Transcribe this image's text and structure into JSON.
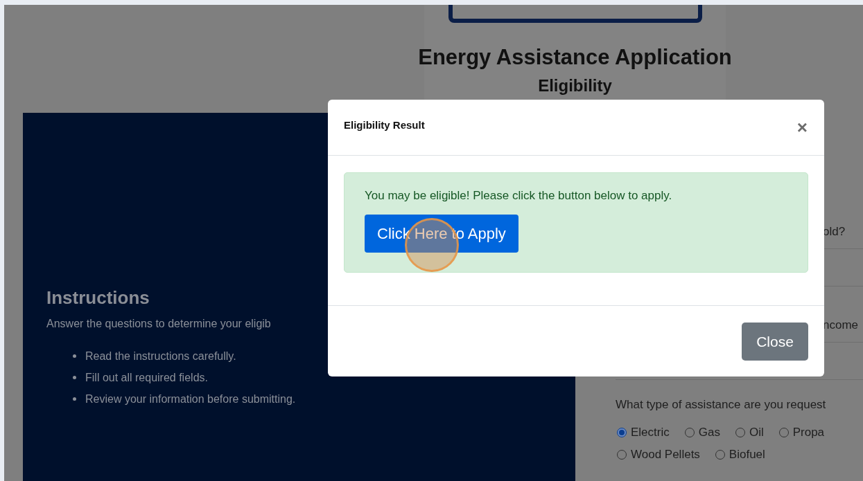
{
  "header": {
    "title": "Energy Assistance Application",
    "subtitle": "Eligibility"
  },
  "instructions": {
    "heading": "Instructions",
    "intro": "Answer the questions to determine your eligib",
    "items": [
      "Read the instructions carefully.",
      "Fill out all required fields.",
      "Review your information before submitting."
    ]
  },
  "form": {
    "fields": [
      {
        "label": "old?"
      },
      {
        "label": "ncome"
      }
    ],
    "assistance": {
      "label": "What type of assistance are you request",
      "options": [
        {
          "label": "Electric",
          "selected": true
        },
        {
          "label": "Gas",
          "selected": false
        },
        {
          "label": "Oil",
          "selected": false
        },
        {
          "label": "Propa",
          "selected": false
        },
        {
          "label": "Wood Pellets",
          "selected": false
        },
        {
          "label": "Biofuel",
          "selected": false
        }
      ]
    }
  },
  "modal": {
    "title": "Eligibility Result",
    "close_icon": "×",
    "message": "You may be eligible! Please click the button below to apply.",
    "apply_button": "Click Here to Apply",
    "close_button": "Close"
  }
}
